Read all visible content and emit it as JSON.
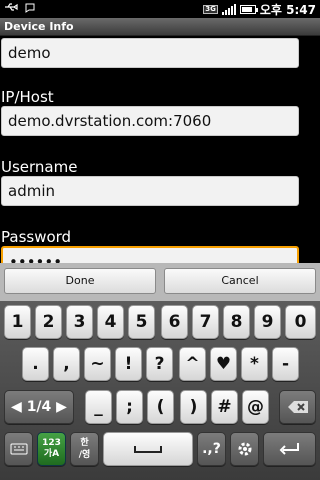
{
  "status_bar": {
    "network": "3G",
    "time": "오후 5:47"
  },
  "title_bar": {
    "title": "Device Info"
  },
  "form": {
    "partial_value": "demo",
    "ip_host": {
      "label": "IP/Host",
      "value": "demo.dvrstation.com:7060"
    },
    "username": {
      "label": "Username",
      "value": "admin"
    },
    "password": {
      "label": "Password",
      "value": "••••••"
    }
  },
  "dialog": {
    "done_label": "Done",
    "cancel_label": "Cancel"
  },
  "keyboard": {
    "row1": [
      "1",
      "2",
      "3",
      "4",
      "5",
      "6",
      "7",
      "8",
      "9",
      "0"
    ],
    "row2": [
      ".",
      ",",
      "~",
      "!",
      "?",
      "^",
      "♥",
      "*",
      "-"
    ],
    "row3": {
      "page": "1/4",
      "keys": [
        "_",
        ";",
        "(",
        ")",
        "#",
        "@"
      ]
    },
    "row4": {
      "mode_key": "123\n가A",
      "lang_key": "한\n/영",
      "punct_key": ".,?"
    }
  },
  "icons": [
    "usb-icon",
    "notification-icon",
    "signal-icon",
    "battery-icon",
    "backspace-icon",
    "keyboard-icon",
    "gear-icon",
    "enter-icon",
    "space-icon"
  ]
}
